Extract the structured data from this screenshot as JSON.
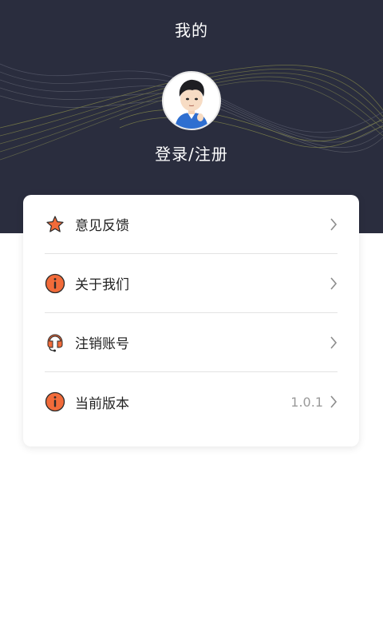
{
  "header": {
    "title": "我的",
    "login_text": "登录/注册",
    "background_color": "#2a2d3e",
    "avatar_icon": "user-avatar"
  },
  "menu": {
    "items": [
      {
        "label": "意见反馈",
        "icon": "star-icon",
        "value": ""
      },
      {
        "label": "关于我们",
        "icon": "info-icon",
        "value": ""
      },
      {
        "label": "注销账号",
        "icon": "headset-icon",
        "value": ""
      },
      {
        "label": "当前版本",
        "icon": "info-icon",
        "value": "1.0.1"
      }
    ],
    "accent_color": "#f26b3a"
  }
}
